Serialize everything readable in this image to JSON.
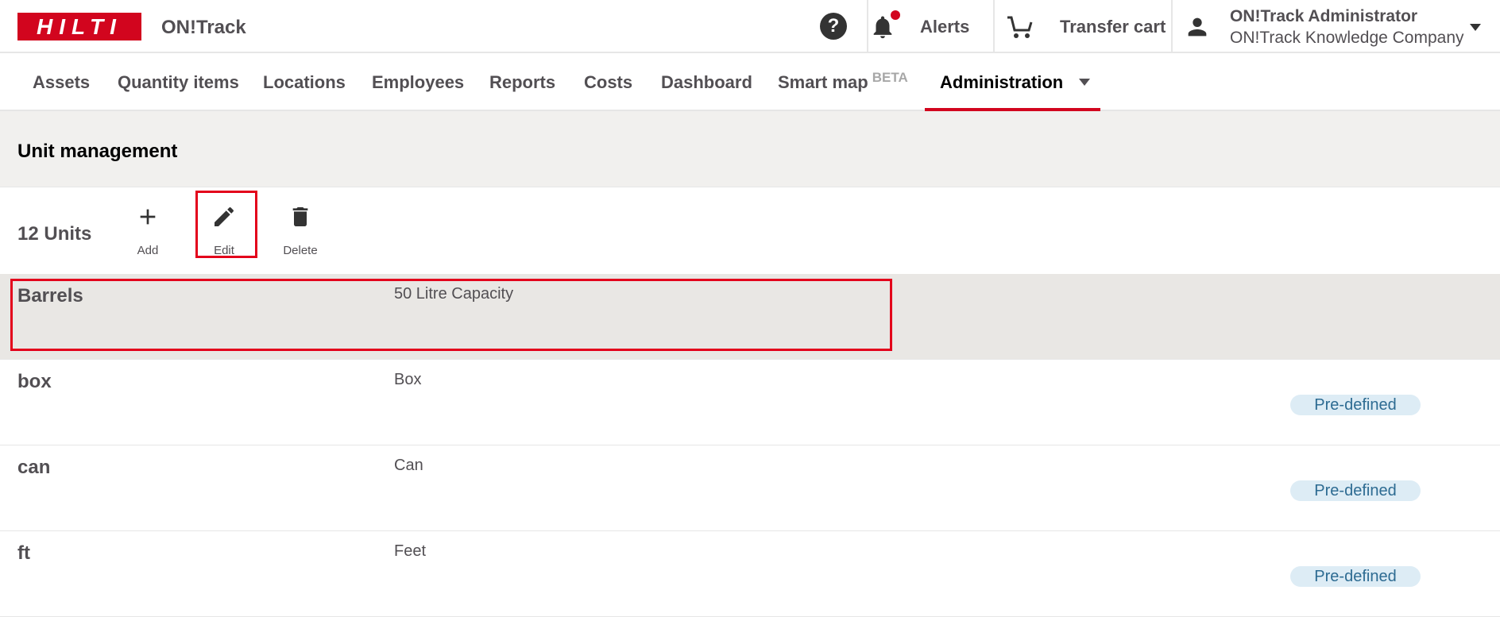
{
  "header": {
    "logo_text": "HILTI",
    "app_name": "ON!Track",
    "help_label": "?",
    "alerts_label": "Alerts",
    "cart_label": "Transfer cart",
    "user_name": "ON!Track Administrator",
    "user_company": "ON!Track Knowledge Company"
  },
  "nav": {
    "items": [
      {
        "label": "Assets"
      },
      {
        "label": "Quantity items"
      },
      {
        "label": "Locations"
      },
      {
        "label": "Employees"
      },
      {
        "label": "Reports"
      },
      {
        "label": "Costs"
      },
      {
        "label": "Dashboard"
      },
      {
        "label": "Smart map",
        "badge": "BETA"
      },
      {
        "label": "Administration",
        "active": true
      }
    ]
  },
  "section": {
    "title": "Unit management"
  },
  "toolbar": {
    "count_label": "12 Units",
    "add_label": "Add",
    "edit_label": "Edit",
    "delete_label": "Delete"
  },
  "units": [
    {
      "name": "Barrels",
      "description": "50 Litre Capacity",
      "badge": "",
      "selected": true
    },
    {
      "name": "box",
      "description": "Box",
      "badge": "Pre-defined",
      "selected": false
    },
    {
      "name": "can",
      "description": "Can",
      "badge": "Pre-defined",
      "selected": false
    },
    {
      "name": "ft",
      "description": "Feet",
      "badge": "Pre-defined",
      "selected": false
    }
  ],
  "colors": {
    "brand_red": "#d2051e",
    "selected_row": "#e9e7e4",
    "badge_bg": "#ddecf5",
    "badge_text": "#2d6b92"
  }
}
